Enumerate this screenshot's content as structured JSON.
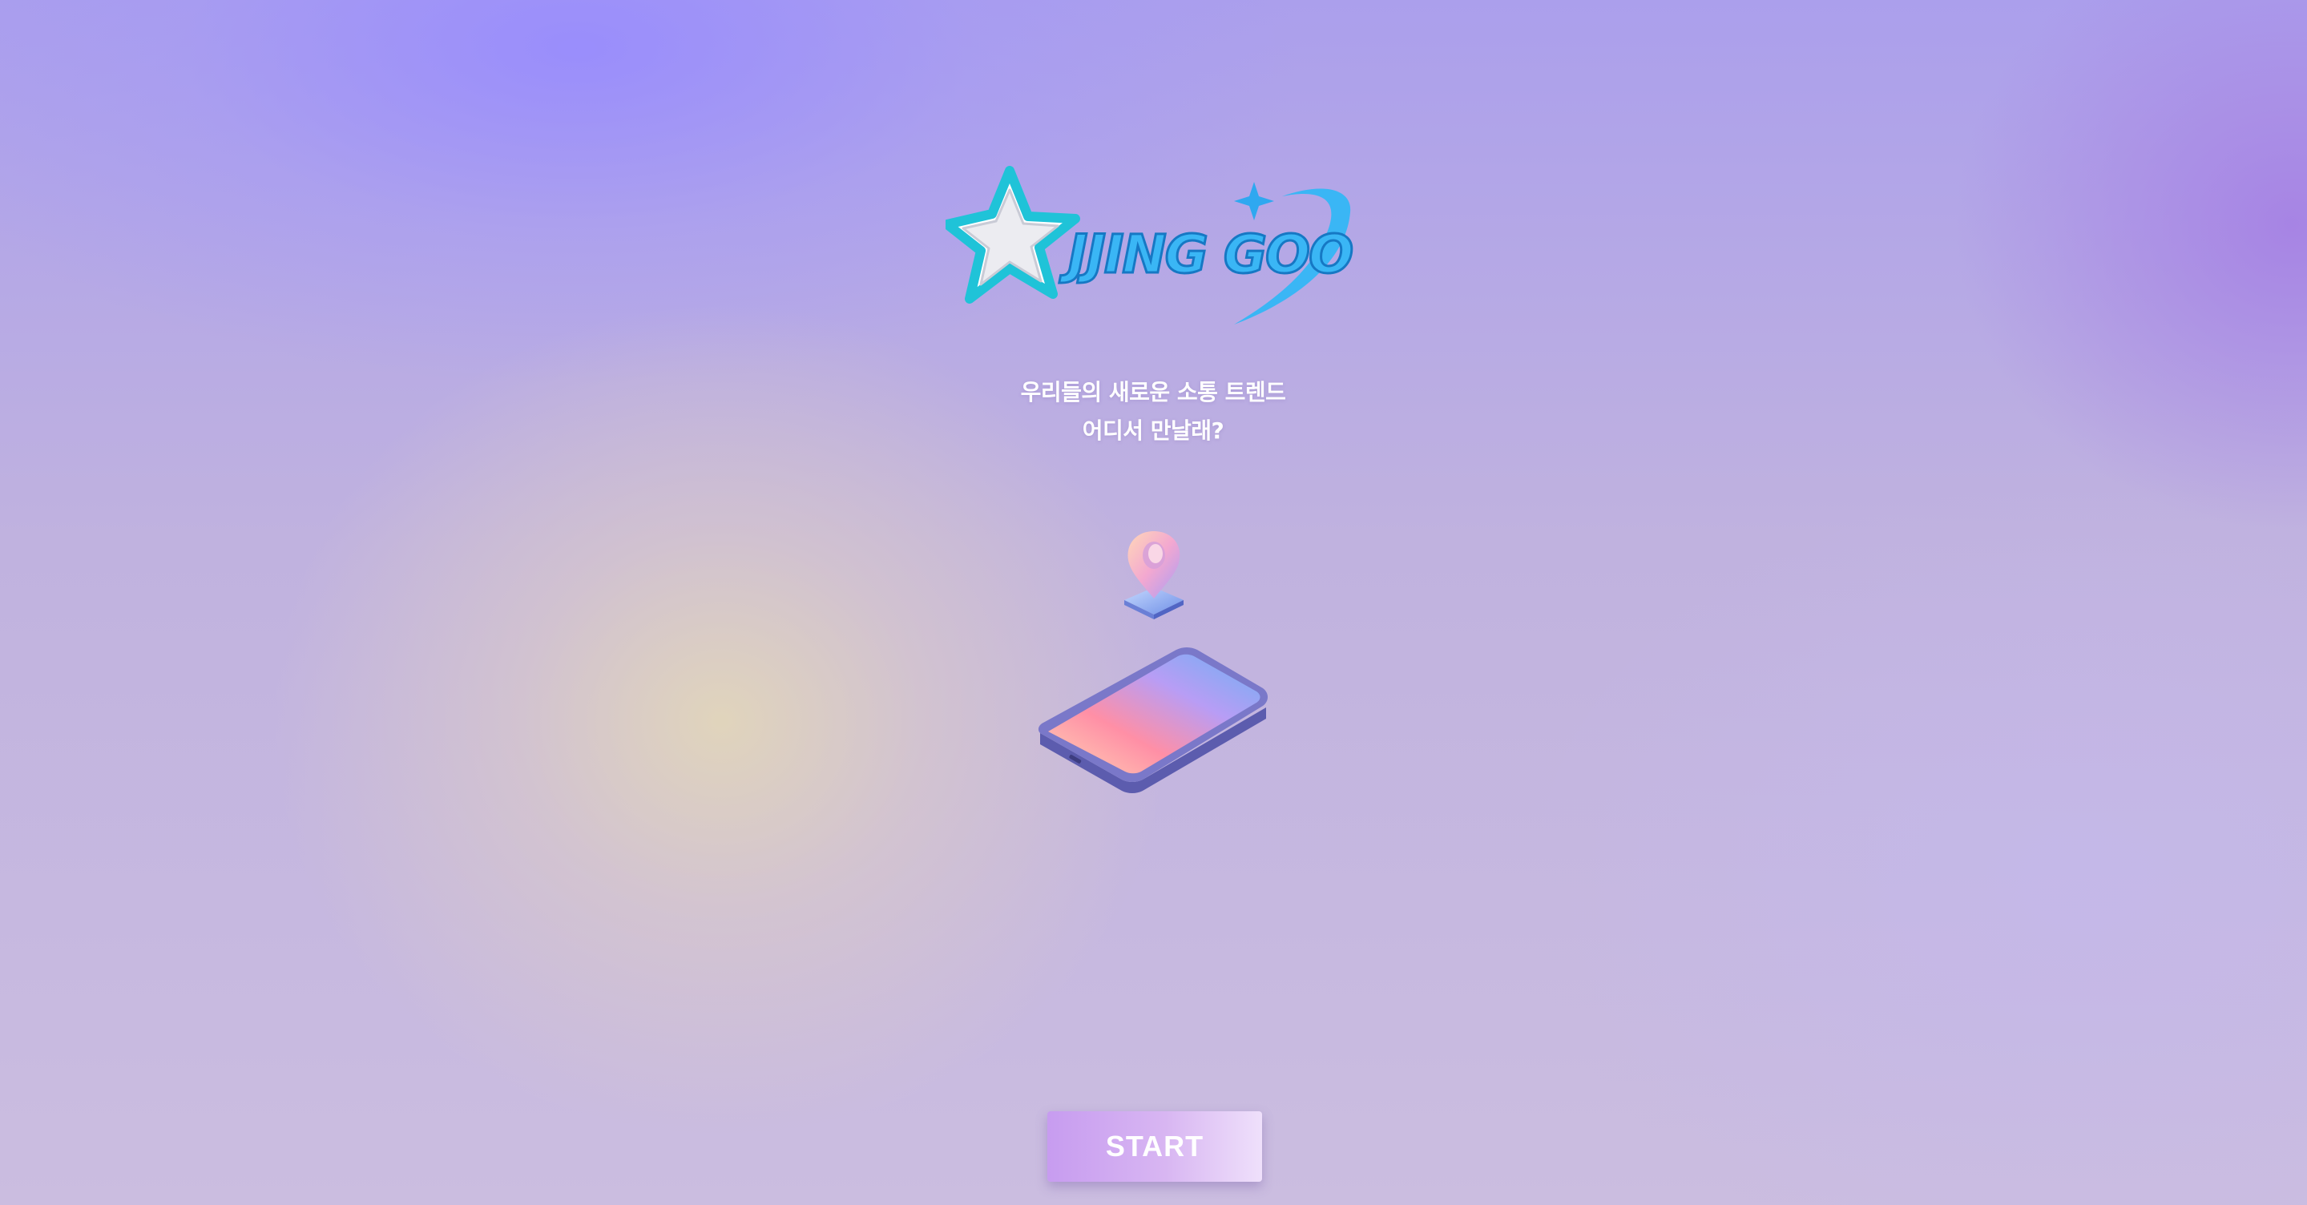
{
  "logo": {
    "text": "JJING GOO",
    "icon": "star-icon",
    "colors": {
      "primary": "#3ab6f5",
      "outline": "#1fc3d8",
      "star_fill": "#f4f4f6"
    }
  },
  "tagline": {
    "line1": "우리들의 새로운 소통 트렌드",
    "line2": "어디서 만날래?"
  },
  "illustration": {
    "pin_icon": "location-pin-icon",
    "phone_icon": "smartphone-icon"
  },
  "start_button": {
    "label": "START",
    "color": "#c79cf0"
  }
}
